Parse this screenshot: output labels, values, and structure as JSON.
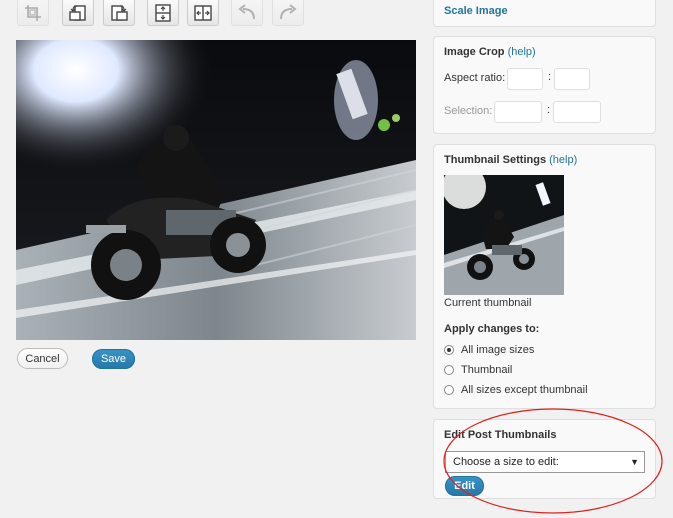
{
  "toolbar": {
    "buttons": [
      {
        "name": "crop-icon",
        "disabled": true
      },
      {
        "name": "rotate-left-icon",
        "disabled": false
      },
      {
        "name": "rotate-right-icon",
        "disabled": false
      },
      {
        "name": "flip-vertical-icon",
        "disabled": false
      },
      {
        "name": "flip-horizontal-icon",
        "disabled": false
      },
      {
        "name": "undo-icon",
        "disabled": true
      },
      {
        "name": "redo-icon",
        "disabled": true
      }
    ]
  },
  "actions": {
    "cancel_label": "Cancel",
    "save_label": "Save"
  },
  "scale": {
    "title": "Scale Image"
  },
  "crop": {
    "title": "Image Crop",
    "help": "(help)",
    "aspect_label": "Aspect ratio:",
    "selection_label": "Selection:",
    "separator": ":"
  },
  "thumbnail": {
    "title": "Thumbnail Settings",
    "help": "(help)",
    "caption": "Current thumbnail",
    "apply_label": "Apply changes to:",
    "options": [
      {
        "label": "All image sizes",
        "checked": true
      },
      {
        "label": "Thumbnail",
        "checked": false
      },
      {
        "label": "All sizes except thumbnail",
        "checked": false
      }
    ]
  },
  "edit_thumbs": {
    "title": "Edit Post Thumbnails",
    "select_value": "Choose a size to edit:",
    "edit_label": "Edit"
  },
  "colors": {
    "accent": "#21759b",
    "annotation": "#e0201b"
  }
}
